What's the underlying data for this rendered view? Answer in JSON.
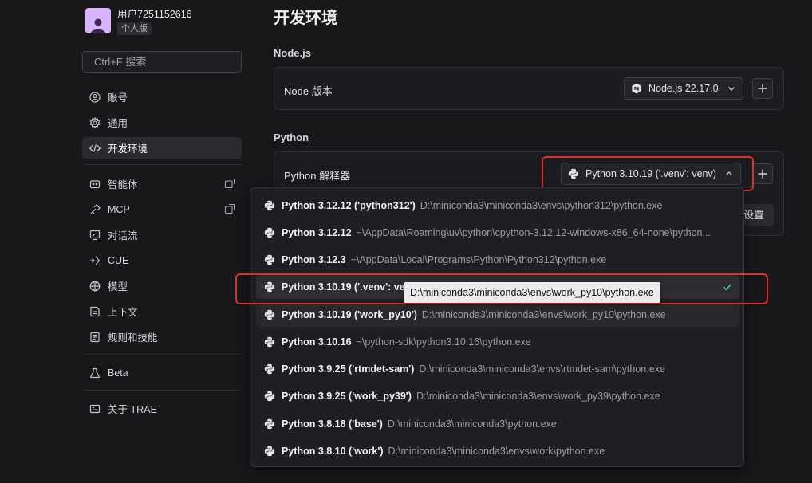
{
  "user": {
    "name": "用户7251152616",
    "plan": "个人版"
  },
  "search": {
    "placeholder": "Ctrl+F 搜索"
  },
  "sidebar": {
    "items": [
      {
        "label": "账号",
        "icon": "account-icon"
      },
      {
        "label": "通用",
        "icon": "gear-icon"
      },
      {
        "label": "开发环境",
        "icon": "code-icon",
        "active": true
      },
      {
        "label": "智能体",
        "icon": "agent-icon"
      },
      {
        "label": "MCP",
        "icon": "mcp-icon"
      },
      {
        "label": "对话流",
        "icon": "chat-flow-icon"
      },
      {
        "label": "CUE",
        "icon": "cue-icon"
      },
      {
        "label": "模型",
        "icon": "model-icon"
      },
      {
        "label": "上下文",
        "icon": "context-icon"
      },
      {
        "label": "规则和技能",
        "icon": "rules-icon"
      },
      {
        "label": "Beta",
        "icon": "beta-icon"
      },
      {
        "label": "关于 TRAE",
        "icon": "about-icon"
      }
    ]
  },
  "main": {
    "title": "开发环境",
    "node": {
      "section": "Node.js",
      "label": "Node 版本",
      "value": "Node.js 22.17.0"
    },
    "python": {
      "section": "Python",
      "label": "Python 解释器",
      "value": "Python 3.10.19 ('.venv': venv)",
      "settings_label": "设置"
    }
  },
  "dropdown": {
    "items": [
      {
        "name": "Python 3.12.12 ('python312')",
        "path": "D:\\miniconda3\\miniconda3\\envs\\python312\\python.exe"
      },
      {
        "name": "Python 3.12.12",
        "path": "~\\AppData\\Roaming\\uv\\python\\cpython-3.12.12-windows-x86_64-none\\python..."
      },
      {
        "name": "Python 3.12.3",
        "path": "~\\AppData\\Local\\Programs\\Python\\Python312\\python.exe"
      },
      {
        "name": "Python 3.10.19 ('.venv': venv)",
        "path": "",
        "selected": true
      },
      {
        "name": "Python 3.10.19 ('work_py10')",
        "path": "D:\\miniconda3\\miniconda3\\envs\\work_py10\\python.exe"
      },
      {
        "name": "Python 3.10.16",
        "path": "~\\python-sdk\\python3.10.16\\python.exe"
      },
      {
        "name": "Python 3.9.25 ('rtmdet-sam')",
        "path": "D:\\miniconda3\\miniconda3\\envs\\rtmdet-sam\\python.exe"
      },
      {
        "name": "Python 3.9.25 ('work_py39')",
        "path": "D:\\miniconda3\\miniconda3\\envs\\work_py39\\python.exe"
      },
      {
        "name": "Python 3.8.18 ('base')",
        "path": "D:\\miniconda3\\miniconda3\\python.exe"
      },
      {
        "name": "Python 3.8.10 ('work')",
        "path": "D:\\miniconda3\\miniconda3\\envs\\work\\python.exe"
      }
    ],
    "tooltip": "D:\\miniconda3\\miniconda3\\envs\\work_py10\\python.exe"
  },
  "colors": {
    "highlight": "#e0302a",
    "check": "#4ade80",
    "avatar": "#d8b4fe"
  }
}
